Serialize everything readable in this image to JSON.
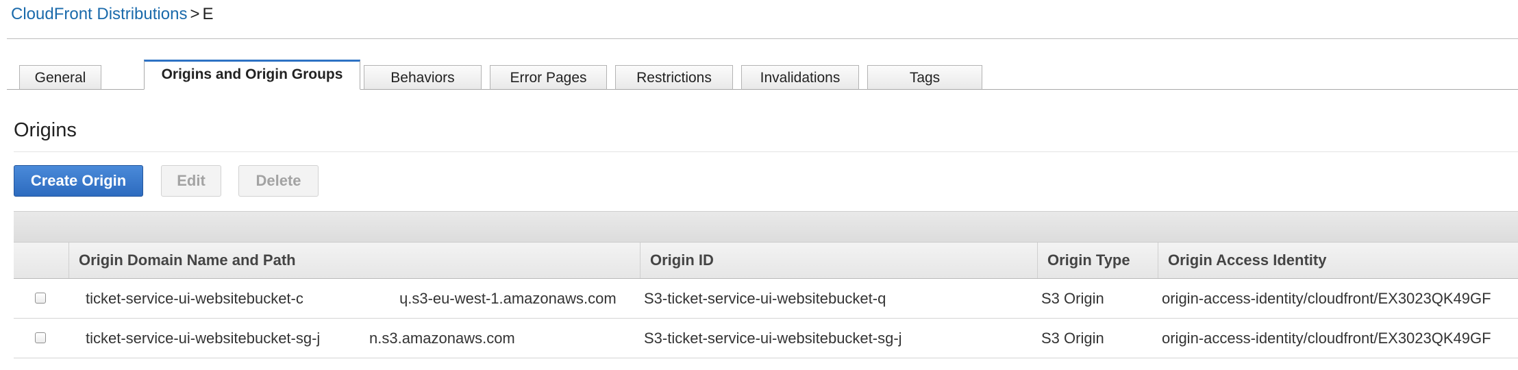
{
  "breadcrumb": {
    "parent": "CloudFront Distributions",
    "separator": ">",
    "current": "E"
  },
  "tabs": [
    {
      "label": "General"
    },
    {
      "label": "Origins and Origin Groups",
      "active": true
    },
    {
      "label": "Behaviors"
    },
    {
      "label": "Error Pages"
    },
    {
      "label": "Restrictions"
    },
    {
      "label": "Invalidations"
    },
    {
      "label": "Tags"
    }
  ],
  "section": {
    "title": "Origins"
  },
  "toolbar": {
    "create_label": "Create Origin",
    "edit_label": "Edit",
    "delete_label": "Delete"
  },
  "table": {
    "columns": [
      "Origin Domain Name and Path",
      "Origin ID",
      "Origin Type",
      "Origin Access Identity"
    ],
    "rows": [
      {
        "domain_start": "ticket-service-ui-websitebucket-c",
        "domain_end": "ɥ.s3-eu-west-1.amazonaws.com",
        "origin_id": "S3-ticket-service-ui-websitebucket-q",
        "origin_type": "S3 Origin",
        "access_identity": "origin-access-identity/cloudfront/EX3023QK49GF"
      },
      {
        "domain_start": "ticket-service-ui-websitebucket-sg-j",
        "domain_end": "n.s3.amazonaws.com",
        "origin_id": "S3-ticket-service-ui-websitebucket-sg-j",
        "origin_type": "S3 Origin",
        "access_identity": "origin-access-identity/cloudfront/EX3023QK49GF"
      }
    ]
  }
}
